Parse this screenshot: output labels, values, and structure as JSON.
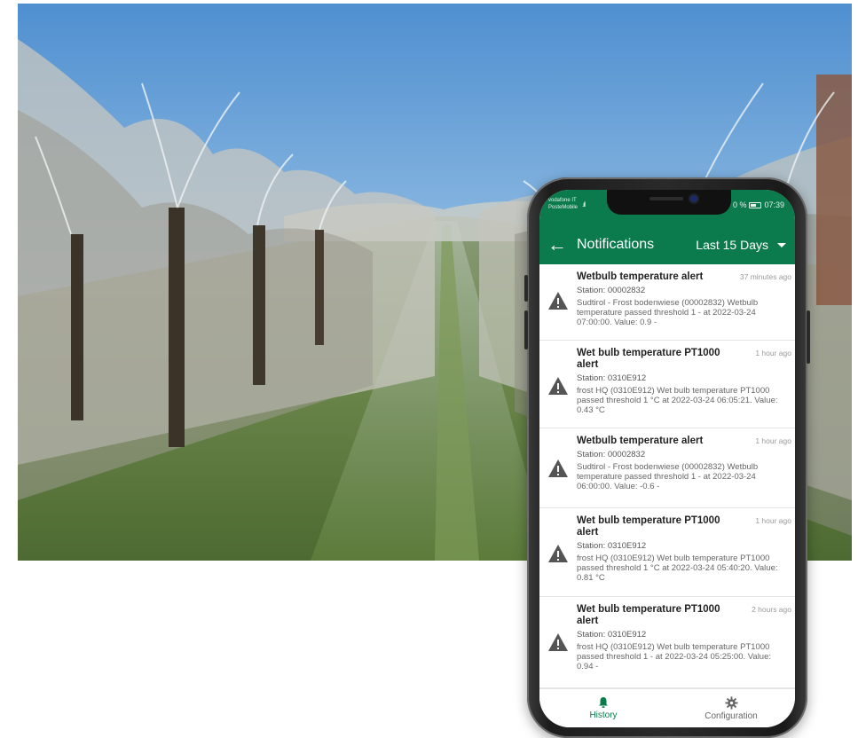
{
  "status_bar": {
    "carrier_line1": "vodafone IT",
    "carrier_line2": "PosteMobile",
    "signal": ".ıll",
    "battery_text": "0 %",
    "time": "07:39"
  },
  "app_bar": {
    "back_icon": "arrow-left-icon",
    "title": "Notifications",
    "range_label": "Last 15 Days"
  },
  "notifications": [
    {
      "title": "Wetbulb temperature alert",
      "time": "37 minutes ago",
      "station": "Station: 00002832",
      "message": "Sudtirol - Frost bodenwiese (00002832) Wetbulb temperature passed threshold 1 - at 2022-03-24 07:00:00. Value: 0.9 -"
    },
    {
      "title": "Wet bulb temperature PT1000 alert",
      "time": "1 hour ago",
      "station": "Station: 0310E912",
      "message": "frost HQ (0310E912) Wet bulb temperature PT1000 passed threshold 1 °C at 2022-03-24 06:05:21. Value: 0.43 °C"
    },
    {
      "title": "Wetbulb temperature alert",
      "time": "1 hour ago",
      "station": "Station: 00002832",
      "message": "Sudtirol - Frost bodenwiese (00002832) Wetbulb temperature passed threshold 1 - at 2022-03-24 06:00:00. Value: -0.6 -"
    },
    {
      "title": "Wet bulb temperature PT1000 alert",
      "time": "1 hour ago",
      "station": "Station: 0310E912",
      "message": "frost HQ (0310E912) Wet bulb temperature PT1000 passed threshold 1 °C at 2022-03-24 05:40:20. Value: 0.81 °C"
    },
    {
      "title": "Wet bulb temperature PT1000 alert",
      "time": "2 hours ago",
      "station": "Station: 0310E912",
      "message": "frost HQ (0310E912) Wet bulb temperature PT1000 passed threshold 1 - at 2022-03-24 05:25:00. Value: 0.94 -"
    }
  ],
  "bottom_nav": {
    "history_label": "History",
    "history_icon": "bell-icon",
    "configuration_label": "Configuration",
    "configuration_icon": "gear-icon"
  },
  "colors": {
    "brand_green": "#0b7a4c",
    "warning_icon": "#555555"
  }
}
